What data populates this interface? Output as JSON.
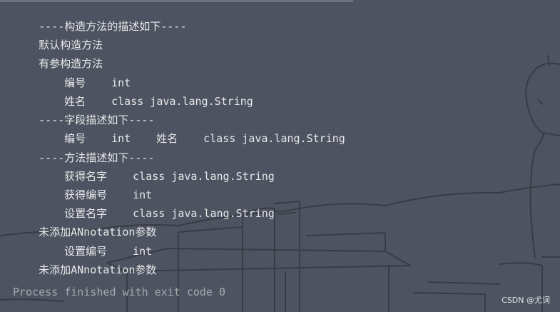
{
  "console": {
    "lines": [
      {
        "text": "----构造方法的描述如下----"
      },
      {
        "text": "默认构造方法"
      },
      {
        "text": "有参构造方法"
      },
      {
        "name": "编号",
        "type": "int"
      },
      {
        "name": "姓名",
        "type": "class java.lang.String"
      },
      {
        "text": "----字段描述如下----"
      },
      {
        "name": "编号",
        "type": "int",
        "name2": "姓名",
        "type2": "class java.lang.String"
      },
      {
        "text": "----方法描述如下----"
      },
      {
        "name": "获得名字",
        "type": "class java.lang.String"
      },
      {
        "name": "获得编号",
        "type": "int"
      },
      {
        "name": "设置名字",
        "type": "class java.lang.String"
      },
      {
        "text": "未添加ANnotation参数"
      },
      {
        "name": "设置编号",
        "type": "int"
      },
      {
        "text": "未添加ANnotation参数"
      }
    ],
    "exit_message": "Process finished with exit code 0"
  },
  "watermark": "CSDN @尤词",
  "colors": {
    "background": "#4d5360",
    "text": "#e8e8ea",
    "dim_text": "#a6a9af",
    "sketch_line": "#383c45"
  }
}
